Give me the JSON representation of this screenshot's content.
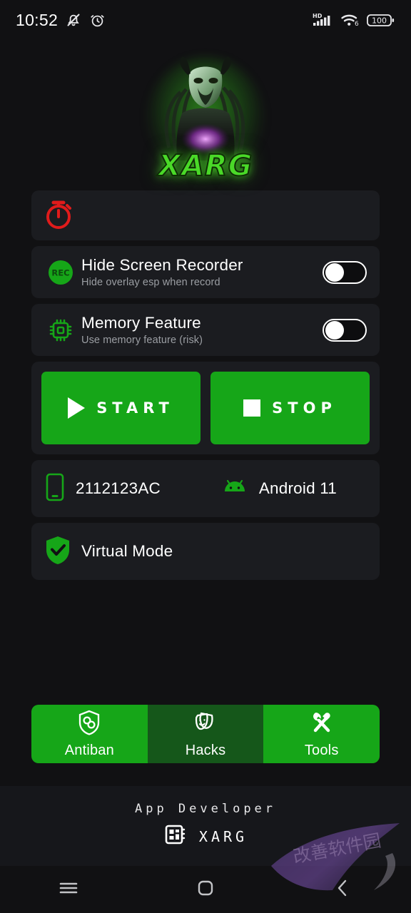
{
  "status_bar": {
    "time": "10:52",
    "left_icons": [
      "bell-off-icon",
      "alarm-icon"
    ],
    "network_label": "HD",
    "wifi_label": "6",
    "battery_level": "100"
  },
  "branding": {
    "logo_wordmark": "XARG",
    "logo_icon": "predator-mascot-logo",
    "accent_green": "#16a618",
    "glow_green": "#4ad928",
    "danger_red": "#e01b1b",
    "card_bg": "#1b1c20",
    "page_bg": "#111113"
  },
  "timer_card": {
    "icon": "stopwatch-icon",
    "icon_color": "#e01b1b"
  },
  "settings": [
    {
      "id": "hide-screen-recorder",
      "icon": "rec-badge-icon",
      "title": "Hide Screen Recorder",
      "subtitle": "Hide overlay esp when record",
      "toggle_state": "off"
    },
    {
      "id": "memory-feature",
      "icon": "cpu-chip-icon",
      "title": "Memory Feature",
      "subtitle": "Use memory feature (risk)",
      "toggle_state": "off"
    }
  ],
  "actions": {
    "start_label": "START",
    "start_icon": "play-icon",
    "stop_label": "STOP",
    "stop_icon": "stop-icon"
  },
  "device": {
    "model_icon": "phone-icon",
    "model": "2112123AC",
    "os_icon": "android-robot-icon",
    "os": "Android 11",
    "virtual_mode_icon": "shield-check-icon",
    "virtual_mode": "Virtual Mode"
  },
  "tabs": [
    {
      "id": "antiban",
      "label": "Antiban",
      "icon": "shield-link-icon",
      "selected": true
    },
    {
      "id": "hacks",
      "label": "Hacks",
      "icon": "theater-masks-icon",
      "selected": false
    },
    {
      "id": "tools",
      "label": "Tools",
      "icon": "wrench-screwdriver-icon",
      "selected": true
    }
  ],
  "footer": {
    "developer_label": "App Developer",
    "developer_icon": "chip-dashboard-icon",
    "developer_name": "XARG"
  },
  "nav_bar": {
    "recents_icon": "menu-icon",
    "home_icon": "home-square-icon",
    "back_icon": "back-chevron-icon"
  },
  "watermark": {
    "text": "改善软件园"
  }
}
